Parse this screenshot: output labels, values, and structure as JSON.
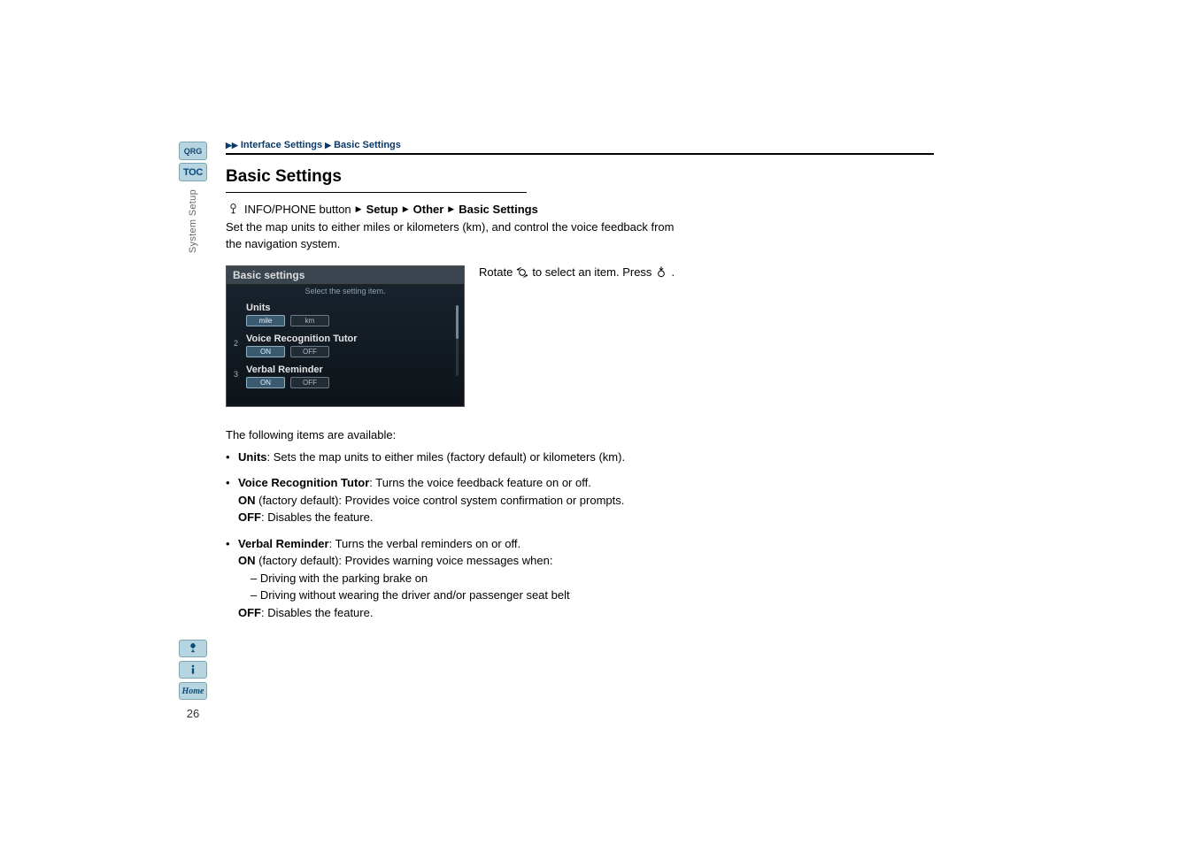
{
  "sidebar": {
    "qrg": "QRG",
    "toc": "TOC",
    "section_label": "System Setup"
  },
  "bottom": {
    "voice_title": "Voice",
    "info_title": "Info",
    "home": "Home",
    "page": "26"
  },
  "breadcrumb": {
    "seg1": "Interface Settings",
    "seg2": "Basic Settings"
  },
  "title": "Basic Settings",
  "path": {
    "button": "INFO/PHONE button",
    "setup": "Setup",
    "other": "Other",
    "basic": "Basic Settings"
  },
  "intro": "Set the map units to either miles or kilometers (km), and control the voice feedback from the navigation system.",
  "screen": {
    "title": "Basic settings",
    "subtitle": "Select the setting item.",
    "units_label": "Units",
    "units_opt1": "mile",
    "units_opt2": "km",
    "vrt_label": "Voice Recognition Tutor",
    "row2_num": "2",
    "on": "ON",
    "off": "OFF",
    "verbal_label": "Verbal Reminder",
    "row3_num": "3"
  },
  "instruction": {
    "part1": "Rotate",
    "part2": "to select an item. Press",
    "part3": "."
  },
  "items_intro": "The following items are available:",
  "items": {
    "units_label": "Units",
    "units_desc": ": Sets the map units to either miles (factory default) or kilometers (km).",
    "vrt_label": "Voice Recognition Tutor",
    "vrt_desc": ": Turns the voice feedback feature on or off.",
    "vrt_on_label": "ON",
    "vrt_on_desc": " (factory default): Provides voice control system confirmation or prompts.",
    "vrt_off_label": "OFF",
    "vrt_off_desc": ": Disables the feature.",
    "verbal_label": "Verbal Reminder",
    "verbal_desc": ": Turns the verbal reminders on or off.",
    "verbal_on_label": "ON",
    "verbal_on_desc": " (factory default): Provides warning voice messages when:",
    "verbal_dash1": "– Driving with the parking brake on",
    "verbal_dash2": "– Driving without wearing the driver and/or passenger seat belt",
    "verbal_off_label": "OFF",
    "verbal_off_desc": ": Disables the feature."
  }
}
